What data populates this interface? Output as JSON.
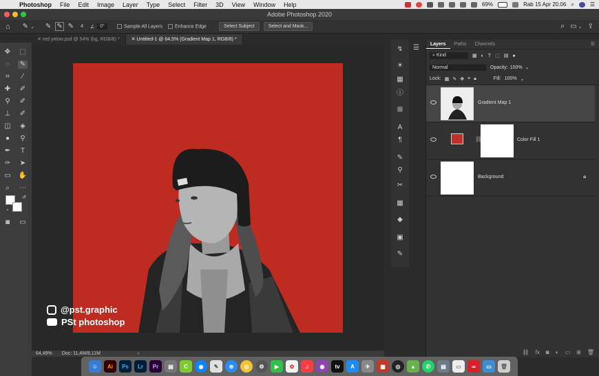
{
  "menubar": {
    "app": "Photoshop",
    "items": [
      "File",
      "Edit",
      "Image",
      "Layer",
      "Type",
      "Select",
      "Filter",
      "3D",
      "View",
      "Window",
      "Help"
    ],
    "battery": "69%",
    "clock": "Rab 15 Apr 20.06"
  },
  "window": {
    "title": "Adobe Photoshop 2020"
  },
  "options": {
    "brush_size": "4",
    "angle": "0°",
    "sample_all": "Sample All Layers",
    "enhance_edge": "Enhance Edge",
    "select_subject": "Select Subject",
    "select_and_mask": "Select and Mask..."
  },
  "tabs": [
    {
      "label": "red yelow.psd @ 54% (bg, RGB/8) *"
    },
    {
      "label": "Untitled-1 @ 64,5% (Gradient Map 1, RGB/8) *"
    }
  ],
  "status": {
    "zoom": "64,49%",
    "doc": "Doc: 11,4M/8,11M",
    "arrow": "›"
  },
  "watermark": {
    "instagram": "@pst.graphic",
    "youtube": "PSt photoshop"
  },
  "layers_panel": {
    "tabs": [
      "Layers",
      "Paths",
      "Channels"
    ],
    "filter_kind": "Kind",
    "blend_mode": "Normal",
    "opacity_label": "Opacity:",
    "opacity_value": "100%",
    "lock_label": "Lock:",
    "fill_label": "Fill:",
    "fill_value": "100%",
    "layers": [
      {
        "name": "Gradient Map 1"
      },
      {
        "name": "Color Fill 1"
      },
      {
        "name": "Background"
      }
    ]
  },
  "colors": {
    "canvas_red": "#bd2b21",
    "fill_swatch": "#c0302a",
    "accent": "#4a90d9"
  }
}
